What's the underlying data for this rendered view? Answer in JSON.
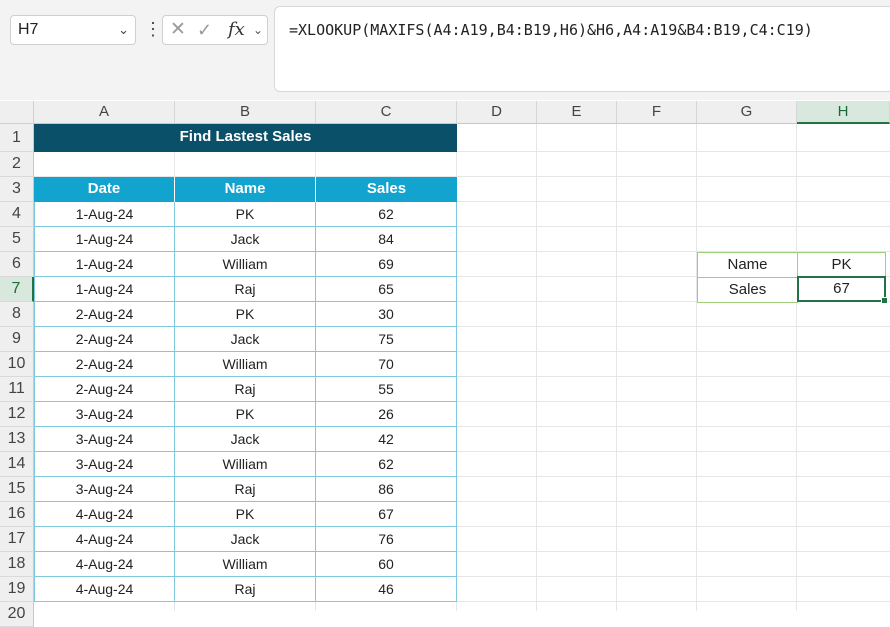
{
  "formula_bar": {
    "name_box": "H7",
    "cancel_icon": "✕",
    "enter_icon": "✓",
    "fx_icon": "fx",
    "formula": "=XLOOKUP(MAXIFS(A4:A19,B4:B19,H6)&H6,A4:A19&B4:B19,C4:C19)"
  },
  "columns": [
    "A",
    "B",
    "C",
    "D",
    "E",
    "F",
    "G",
    "H"
  ],
  "selected_column": "H",
  "rows": [
    "1",
    "2",
    "3",
    "4",
    "5",
    "6",
    "7",
    "8",
    "9",
    "10",
    "11",
    "12",
    "13",
    "14",
    "15",
    "16",
    "17",
    "18",
    "19",
    "20"
  ],
  "selected_row": "7",
  "table": {
    "title": "Find Lastest Sales",
    "headers": [
      "Date",
      "Name",
      "Sales"
    ],
    "records": [
      [
        "1-Aug-24",
        "PK",
        "62"
      ],
      [
        "1-Aug-24",
        "Jack",
        "84"
      ],
      [
        "1-Aug-24",
        "William",
        "69"
      ],
      [
        "1-Aug-24",
        "Raj",
        "65"
      ],
      [
        "2-Aug-24",
        "PK",
        "30"
      ],
      [
        "2-Aug-24",
        "Jack",
        "75"
      ],
      [
        "2-Aug-24",
        "William",
        "70"
      ],
      [
        "2-Aug-24",
        "Raj",
        "55"
      ],
      [
        "3-Aug-24",
        "PK",
        "26"
      ],
      [
        "3-Aug-24",
        "Jack",
        "42"
      ],
      [
        "3-Aug-24",
        "William",
        "62"
      ],
      [
        "3-Aug-24",
        "Raj",
        "86"
      ],
      [
        "4-Aug-24",
        "PK",
        "67"
      ],
      [
        "4-Aug-24",
        "Jack",
        "76"
      ],
      [
        "4-Aug-24",
        "William",
        "60"
      ],
      [
        "4-Aug-24",
        "Raj",
        "46"
      ]
    ]
  },
  "lookup": {
    "name_label": "Name",
    "name_value": "PK",
    "sales_label": "Sales",
    "sales_value": "67"
  },
  "colors": {
    "title_bg": "#0a5068",
    "header_bg": "#12a3cf",
    "table_border": "#7fc8e0",
    "lookup_border": "#9ccf7a",
    "selection": "#217346"
  }
}
